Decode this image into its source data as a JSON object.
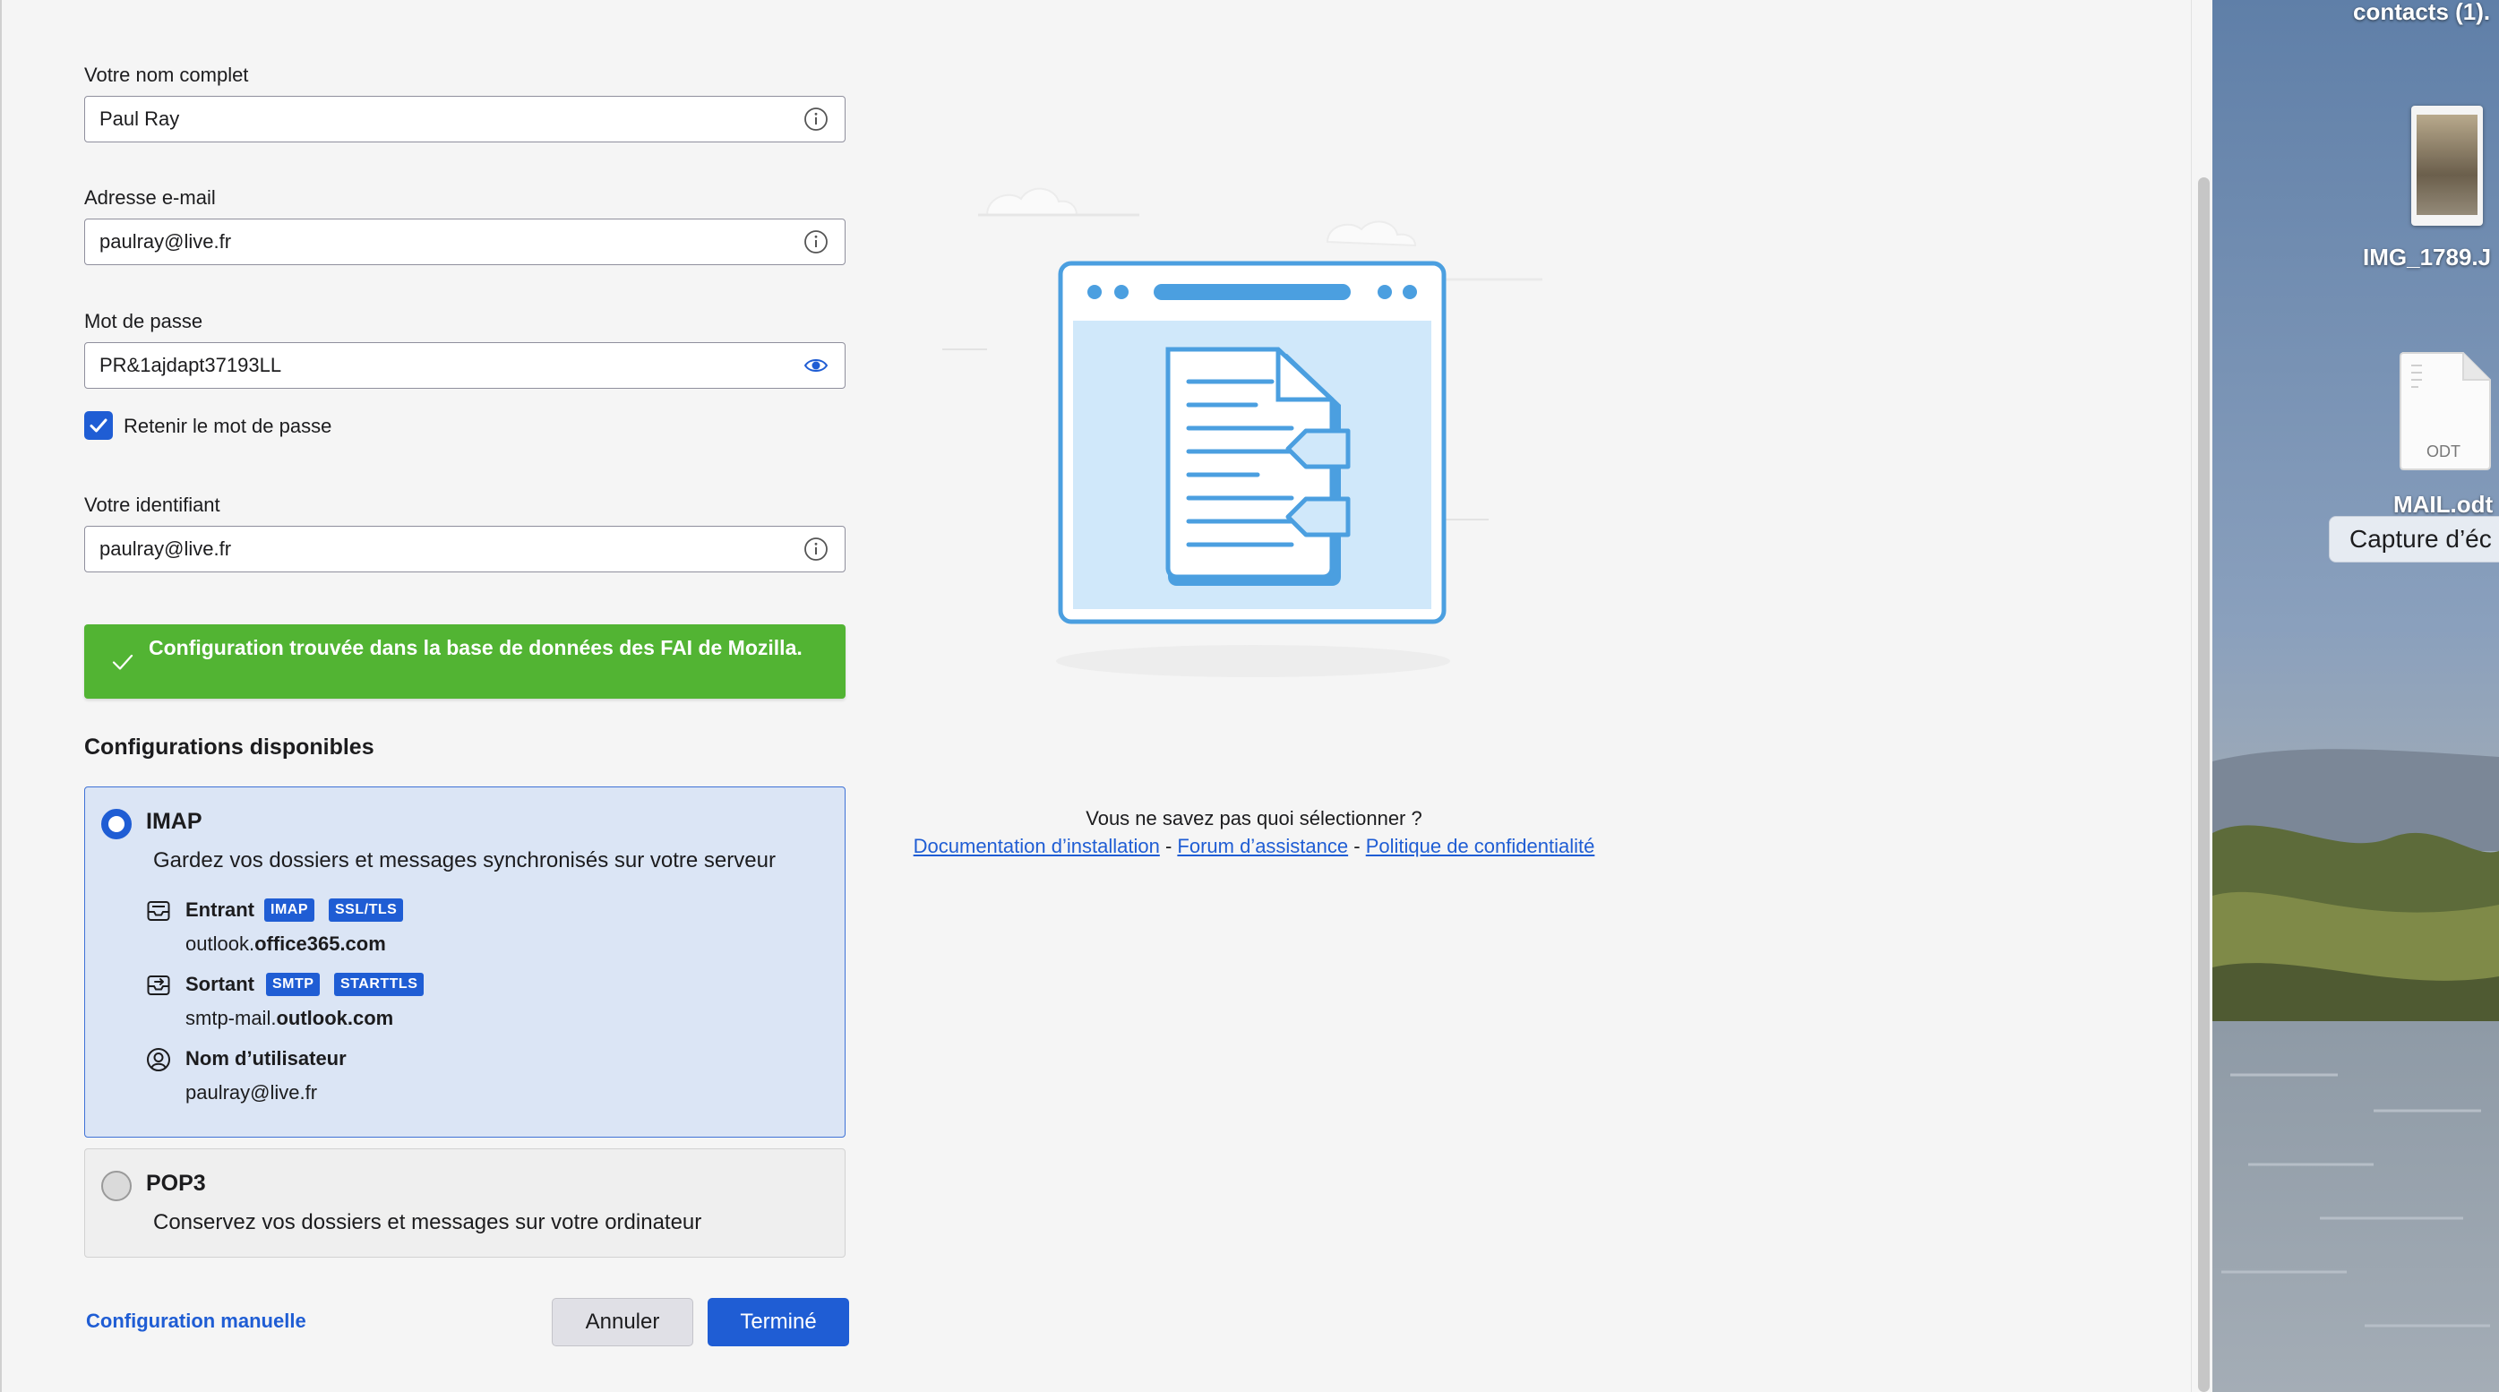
{
  "form": {
    "fullname_label": "Votre nom complet",
    "fullname_value": "Paul Ray",
    "email_label": "Adresse e-mail",
    "email_value": "paulray@live.fr",
    "password_label": "Mot de passe",
    "password_value": "PR&1ajdapt37193LL",
    "remember_label": "Retenir le mot de passe",
    "remember_checked": true,
    "username_label": "Votre identifiant",
    "username_value": "paulray@live.fr"
  },
  "success_message": "Configuration trouvée dans la base de données des FAI de Mozilla.",
  "configs": {
    "title": "Configurations disponibles",
    "imap": {
      "title": "IMAP",
      "description": "Gardez vos dossiers et messages synchronisés sur votre serveur",
      "selected": true,
      "incoming": {
        "label": "Entrant",
        "badges": [
          "IMAP",
          "SSL/TLS"
        ],
        "host_prefix": "outlook.",
        "host_bold": "office365.com"
      },
      "outgoing": {
        "label": "Sortant",
        "badges": [
          "SMTP",
          "STARTTLS"
        ],
        "host_prefix": "smtp-mail.",
        "host_bold": "outlook.com"
      },
      "user": {
        "label": "Nom d’utilisateur",
        "value": "paulray@live.fr"
      }
    },
    "pop3": {
      "title": "POP3",
      "description": "Conservez vos dossiers et messages sur votre ordinateur",
      "selected": false
    }
  },
  "footer": {
    "manual_config": "Configuration manuelle",
    "cancel": "Annuler",
    "done": "Terminé"
  },
  "help": {
    "question": "Vous ne savez pas quoi sélectionner ?",
    "link_install": "Documentation d’installation",
    "separator": "-",
    "link_forum": "Forum d’assistance",
    "link_privacy": "Politique de confidentialité"
  },
  "desktop": {
    "contacts_label": "contacts (1).",
    "img_label": "IMG_1789.J",
    "odt_type": "ODT",
    "mail_label": "MAIL.odt",
    "tooltip": "Capture d’éc"
  },
  "icons": {
    "info": "info-icon",
    "eye": "eye-icon",
    "check": "checkmark-icon",
    "incoming": "inbox-icon",
    "outgoing": "outbox-icon",
    "user": "user-icon"
  },
  "colors": {
    "accent": "#1f5dd4",
    "success": "#52b433",
    "selected_card": "#dbe5f5",
    "illustration_blue": "#4b9fe0"
  }
}
